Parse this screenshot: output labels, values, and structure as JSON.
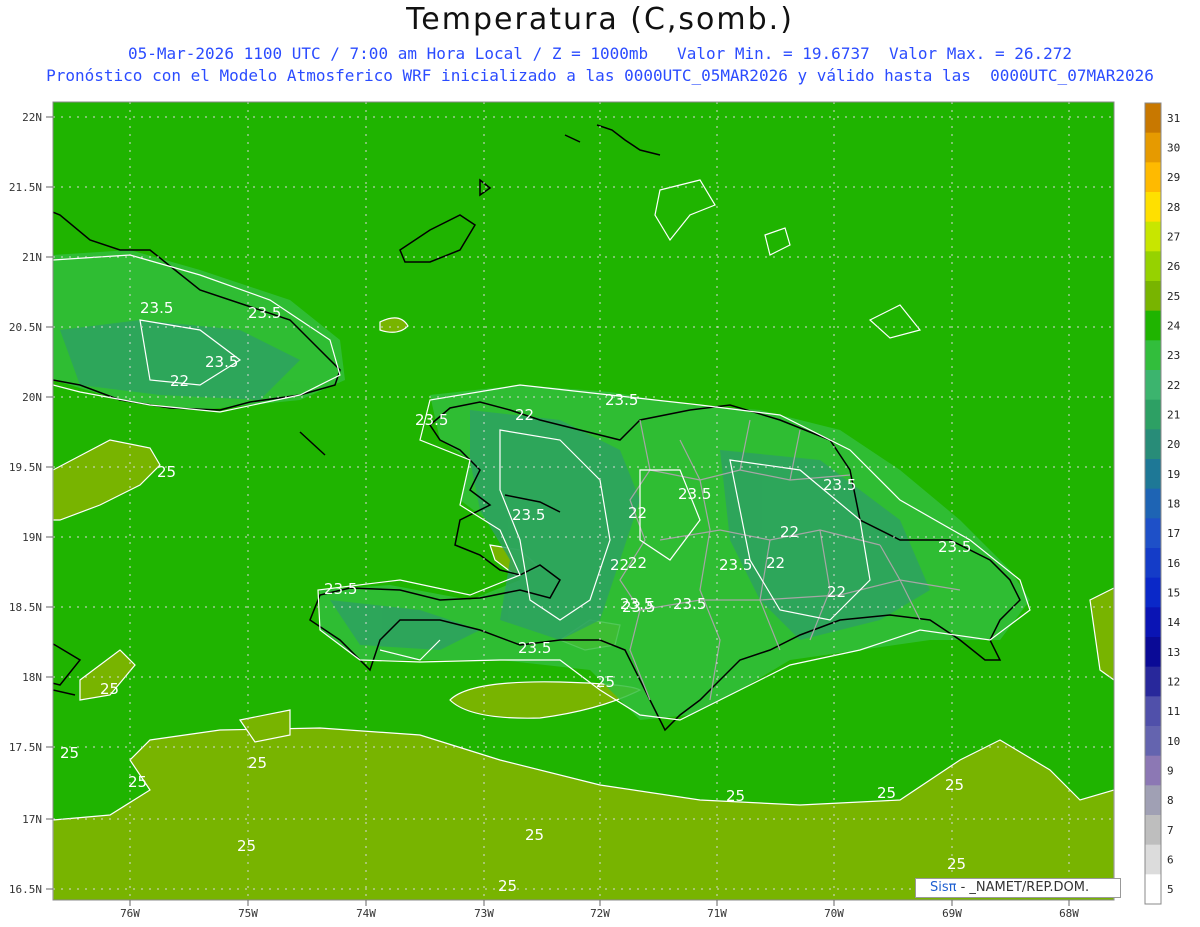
{
  "header": {
    "title": "Temperatura (C,somb.)",
    "line1": "05-Mar-2026 1100 UTC / 7:00 am Hora Local / Z = 1000mb   Valor Min. = 19.6737  Valor Max. = 26.272",
    "line2": "Pronóstico con el Modelo Atmosferico WRF inicializado a las 0000UTC_05MAR2026 y válido hasta las  0000UTC_07MAR2026"
  },
  "axes": {
    "lat_ticks": [
      "22N",
      "21.5N",
      "21N",
      "20.5N",
      "20N",
      "19.5N",
      "19N",
      "18.5N",
      "18N",
      "17.5N",
      "17N",
      "16.5N"
    ],
    "lon_ticks": [
      "76W",
      "75W",
      "74W",
      "73W",
      "72W",
      "71W",
      "70W",
      "69W",
      "68W"
    ]
  },
  "colorbar": {
    "levels": [
      "31",
      "30",
      "29",
      "28",
      "27",
      "26",
      "25",
      "24",
      "23",
      "22",
      "21",
      "20",
      "19",
      "18",
      "17",
      "16",
      "15",
      "14",
      "13",
      "12",
      "11",
      "10",
      "9",
      "8",
      "7",
      "6",
      "5"
    ],
    "colors": [
      "#c87800",
      "#e69a00",
      "#ffba00",
      "#ffe000",
      "#c8e600",
      "#96d200",
      "#78b400",
      "#1fb400",
      "#32be3c",
      "#3cb46e",
      "#2da064",
      "#288c78",
      "#1e7896",
      "#1e64b4",
      "#1e50c8",
      "#143cc8",
      "#0a28c8",
      "#0a14b4",
      "#0a0a96",
      "#28289b",
      "#5050aa",
      "#6464af",
      "#8c78b4",
      "#a0a0b4",
      "#bebebe",
      "#dcdcdc",
      "#ffffff"
    ]
  },
  "contour_labels": [
    "23.5",
    "23.5",
    "23.5",
    "22",
    "23.5",
    "22",
    "25",
    "23.5",
    "23.5",
    "22",
    "23.5",
    "23.5",
    "22",
    "23.5",
    "22",
    "22",
    "23.5",
    "23.5",
    "22",
    "23.5",
    "23.5",
    "23.5",
    "22",
    "23.5",
    "25",
    "25",
    "25",
    "25",
    "25",
    "25",
    "25",
    "25",
    "25",
    "25",
    "25",
    "25"
  ],
  "credit": {
    "logo": "Sisπ",
    "text": "- _NAMET/REP.DOM."
  }
}
